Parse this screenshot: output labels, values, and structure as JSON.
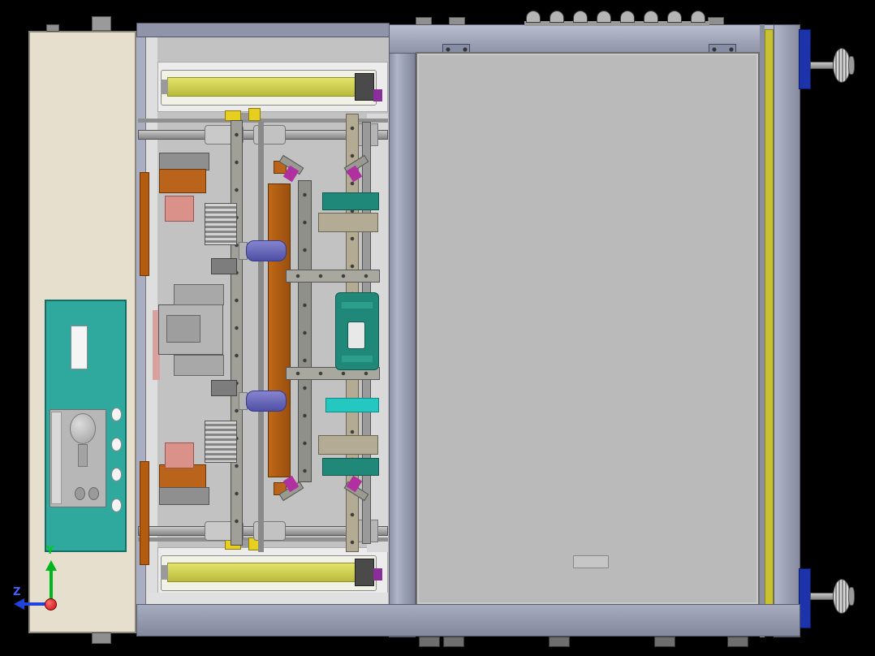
{
  "triad": {
    "y_label": "Y",
    "z_label": "Z"
  },
  "colors": {
    "background": "#000000",
    "frame_lavender_gray": "#9aa0b4",
    "panel_beige": "#e7dfce",
    "hmi_teal": "#2fa89e",
    "light_curtain_yellow": "#d8d854",
    "edge_strip_yellow": "#c8c233",
    "copper_orange": "#b35c10",
    "bracket_teal": "#1f8878",
    "bright_cyan": "#25c8c0",
    "cylinder_purple": "#6b6bc0",
    "corner_block_blue": "#1d33aa",
    "door_plate_gray": "#bababa",
    "magenta_clamp": "#b030a0",
    "axis_y_green": "#00b41e",
    "axis_z_blue": "#2244dd",
    "axis_x_red": "#cc1111"
  }
}
